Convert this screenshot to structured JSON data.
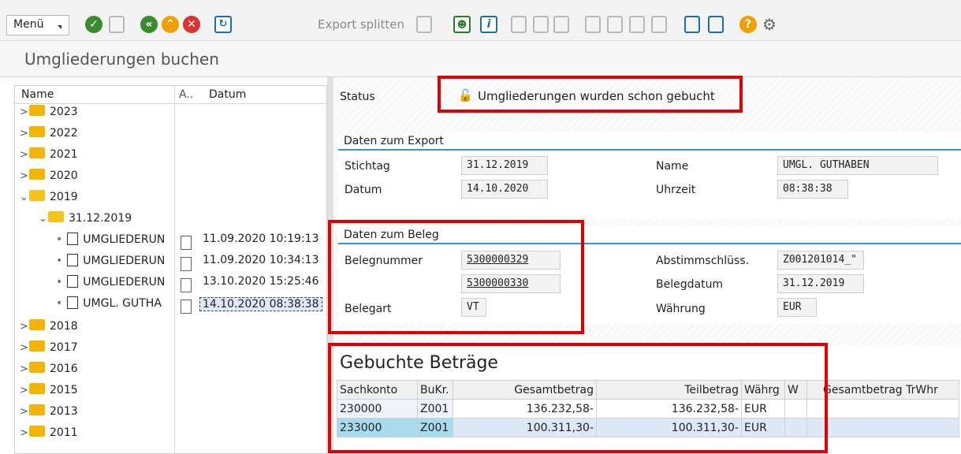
{
  "toolbar": {
    "menu_label": "Menü",
    "export_split_label": "Export splitten"
  },
  "page": {
    "title": "Umgliederungen buchen"
  },
  "tree": {
    "header_name": "Name",
    "header_col2": "A..",
    "header_date": "Datum",
    "years_top": [
      "2023",
      "2022",
      "2021",
      "2020"
    ],
    "year_open": "2019",
    "subfolder": "31.12.2019",
    "docs": [
      {
        "name": "UMGLIEDERUN",
        "date": "11.09.2020 10:19:13"
      },
      {
        "name": "UMGLIEDERUN",
        "date": "11.09.2020 10:34:13"
      },
      {
        "name": "UMGLIEDERUN",
        "date": "13.10.2020 15:25:46"
      },
      {
        "name": "UMGL. GUTHA",
        "date": "14.10.2020 08:38:38"
      }
    ],
    "years_bottom": [
      "2018",
      "2017",
      "2016",
      "2015",
      "2013",
      "2011"
    ]
  },
  "status": {
    "label": "Status",
    "text": "Umgliederungen wurden schon  gebucht"
  },
  "export": {
    "heading": "Daten zum Export",
    "stichtag_label": "Stichtag",
    "stichtag_value": "31.12.2019",
    "datum_label": "Datum",
    "datum_value": "14.10.2020",
    "name_label": "Name",
    "name_value": "UMGL. GUTHABEN",
    "uhrzeit_label": "Uhrzeit",
    "uhrzeit_value": "08:38:38"
  },
  "beleg": {
    "heading": "Daten zum Beleg",
    "belegnummer_label": "Belegnummer",
    "belegnummer_value1": "5300000329",
    "belegnummer_value2": "5300000330",
    "belegart_label": "Belegart",
    "belegart_value": "VT",
    "abstimm_label": "Abstimmschlüss.",
    "abstimm_value": "Z001201014_\"",
    "belegdatum_label": "Belegdatum",
    "belegdatum_value": "31.12.2019",
    "waehrung_label": "Währung",
    "waehrung_value": "EUR"
  },
  "betraege": {
    "title": "Gebuchte Beträge",
    "columns": [
      "Sachkonto",
      "BuKr.",
      "Gesamtbetrag",
      "Teilbetrag",
      "Währg",
      "W",
      "Gesamtbetrag TrWhr"
    ],
    "rows": [
      {
        "sachkonto": "230000",
        "bukr": "Z001",
        "gesamt": "136.232,58-",
        "teil": "136.232,58-",
        "waehrg": "EUR"
      },
      {
        "sachkonto": "233000",
        "bukr": "Z001",
        "gesamt": "100.311,30-",
        "teil": "100.311,30-",
        "waehrg": "EUR"
      }
    ]
  },
  "colors": {
    "accent_blue": "#3a92d3",
    "highlight_red": "#e00000",
    "folder_yellow": "#f5b400",
    "selected_row": "#cfe3f5"
  }
}
